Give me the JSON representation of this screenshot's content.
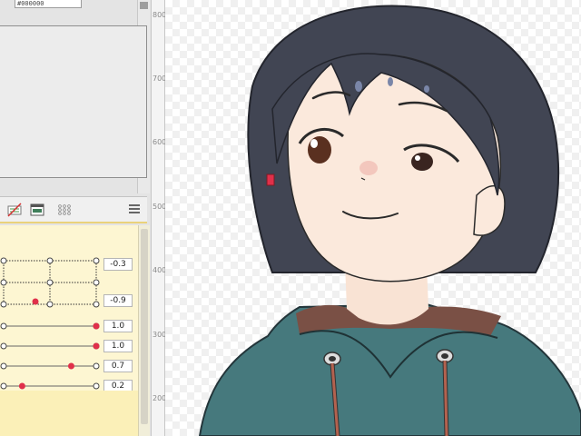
{
  "color_field": {
    "value": "#000000"
  },
  "ruler": {
    "labels": [
      "800",
      "700",
      "600",
      "500",
      "400",
      "300",
      "200"
    ]
  },
  "tools": [
    {
      "icon": "no-image-icon"
    },
    {
      "icon": "display-icon"
    },
    {
      "icon": "grid-options-icon"
    },
    {
      "icon": "hamburger-menu-icon"
    }
  ],
  "params": {
    "mesh_top_value": "-0.3",
    "mesh_bottom_value": "-0.9",
    "sliders": [
      {
        "value": "1.0",
        "level": 1.0
      },
      {
        "value": "1.0",
        "level": 1.0
      },
      {
        "value": "0.7",
        "level": 0.73
      },
      {
        "value": "0.2",
        "level": 0.2
      }
    ]
  },
  "colors": {
    "hair": "#414553",
    "skin": "#fbe9dc",
    "hoodie": "#46797d",
    "accent": "#e0304a"
  }
}
